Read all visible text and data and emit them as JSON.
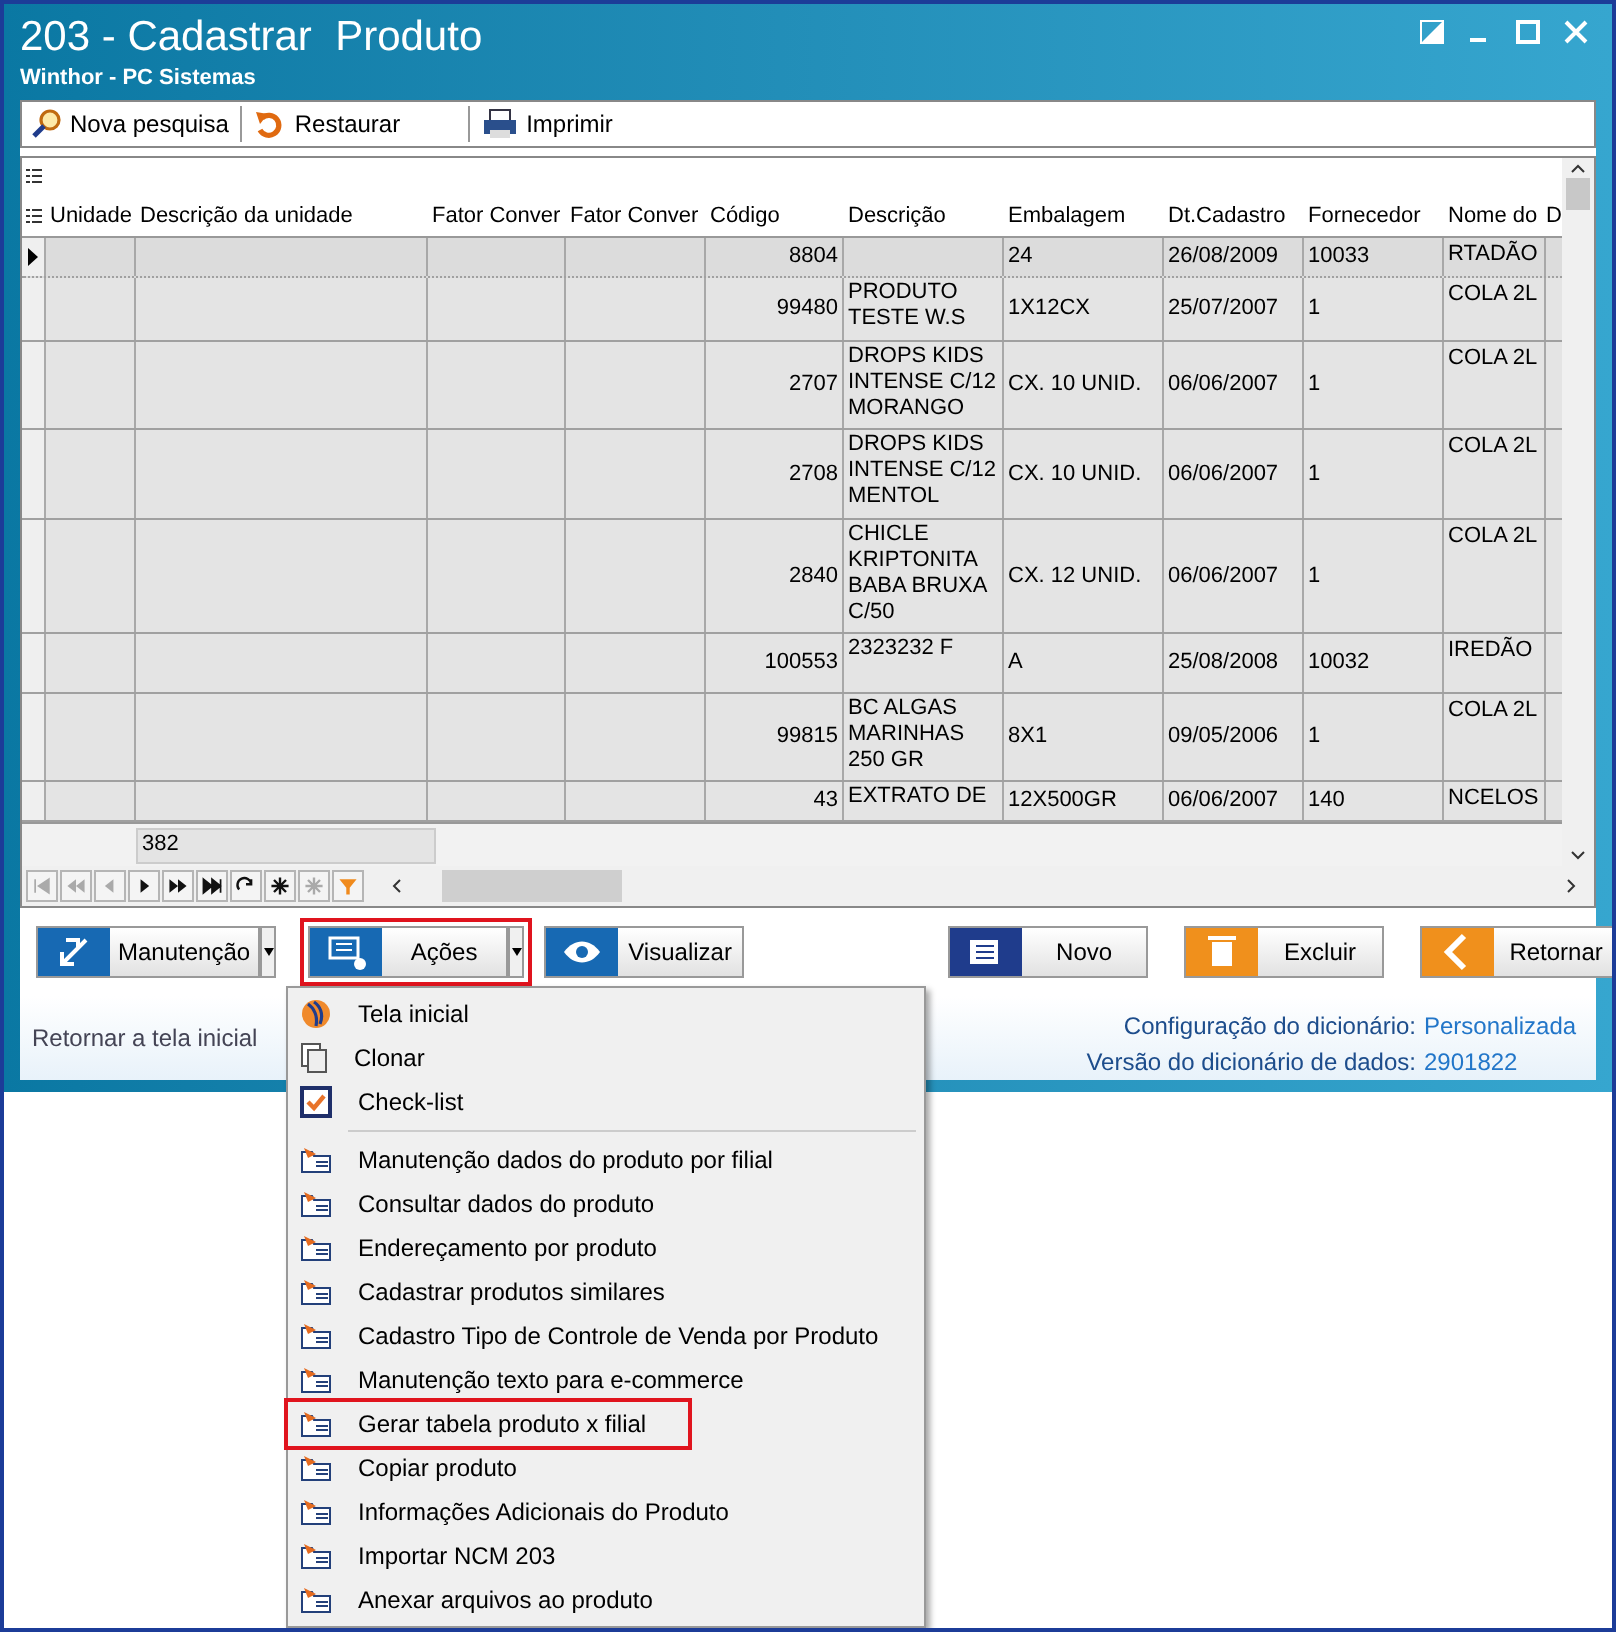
{
  "window": {
    "title": "203 - Cadastrar  Produto",
    "subtitle": "Winthor - PC Sistemas"
  },
  "toolbar": [
    {
      "label": "Nova pesquisa"
    },
    {
      "label": "Restaurar"
    },
    {
      "label": "Imprimir"
    }
  ],
  "table": {
    "columns": [
      "Unidade",
      "Descrição da unidade",
      "Fator Conver",
      "Fator Conver",
      "Código",
      "Descrição",
      "Embalagem",
      "Dt.Cadastro",
      "Fornecedor",
      "Nome do",
      "D"
    ],
    "rows": [
      {
        "selected": true,
        "cells": [
          "",
          "",
          "",
          "",
          "8804",
          "",
          "24",
          "26/08/2009",
          "10033",
          "RTADÃO"
        ]
      },
      {
        "selected": false,
        "cells": [
          "",
          "",
          "",
          "",
          "99480",
          "PRODUTO TESTE W.S",
          "1X12CX",
          "25/07/2007",
          "1",
          "COLA 2L"
        ]
      },
      {
        "selected": false,
        "cells": [
          "",
          "",
          "",
          "",
          "2707",
          "DROPS KIDS INTENSE C/12 MORANGO",
          "CX. 10 UNID.",
          "06/06/2007",
          "1",
          "COLA 2L"
        ]
      },
      {
        "selected": false,
        "cells": [
          "",
          "",
          "",
          "",
          "2708",
          "DROPS KIDS INTENSE C/12 MENTOL",
          "CX. 10 UNID.",
          "06/06/2007",
          "1",
          "COLA 2L"
        ]
      },
      {
        "selected": false,
        "cells": [
          "",
          "",
          "",
          "",
          "2840",
          "CHICLE KRIPTONITA BABA BRUXA C/50",
          "CX. 12 UNID.",
          "06/06/2007",
          "1",
          "COLA 2L"
        ]
      },
      {
        "selected": false,
        "cells": [
          "",
          "",
          "",
          "",
          "100553",
          "2323232 F",
          "A",
          "25/08/2008",
          "10032",
          "IREDÃO"
        ]
      },
      {
        "selected": false,
        "cells": [
          "",
          "",
          "",
          "",
          "99815",
          "BC ALGAS MARINHAS 250 GR",
          "8X1",
          "09/05/2006",
          "1",
          "COLA 2L"
        ]
      },
      {
        "selected": false,
        "cells": [
          "",
          "",
          "",
          "",
          "43",
          "EXTRATO DE",
          "12X500GR",
          "06/06/2007",
          "140",
          "NCELOS"
        ]
      }
    ],
    "summary": "382"
  },
  "navigator": [
    {
      "disabled": true
    },
    {
      "disabled": true
    },
    {
      "disabled": true
    },
    {
      "disabled": false
    },
    {
      "disabled": false
    },
    {
      "disabled": false
    },
    {
      "disabled": false
    },
    {
      "disabled": false
    },
    {
      "disabled": true
    },
    {
      "disabled": false
    }
  ],
  "buttons": [
    {
      "label": "Manutenção",
      "dropdown": true,
      "highlighted": false,
      "color": "#1769b3"
    },
    {
      "label": "Ações",
      "dropdown": true,
      "highlighted": true,
      "color": "#1769b3"
    },
    {
      "label": "Visualizar",
      "dropdown": false,
      "highlighted": false,
      "color": "#1769b3"
    },
    {
      "label": "Novo",
      "dropdown": false,
      "highlighted": false,
      "color": "#1f3c8c"
    },
    {
      "label": "Excluir",
      "dropdown": false,
      "highlighted": false,
      "color": "#f0901c"
    },
    {
      "label": "Retornar",
      "dropdown": false,
      "highlighted": false,
      "color": "#f0901c"
    }
  ],
  "footer": {
    "link": "Retornar a tela inicial",
    "info": [
      {
        "label": "Configuração do dicionário:",
        "value": "Personalizada"
      },
      {
        "label": "Versão do dicionário de dados:",
        "value": "2901822"
      }
    ]
  },
  "menu": {
    "groups": [
      [
        {
          "label": "Tela inicial",
          "highlighted": false
        },
        {
          "label": "Clonar",
          "highlighted": false
        },
        {
          "label": "Check-list",
          "highlighted": false
        }
      ],
      [
        {
          "label": "Manutenção dados do produto por filial",
          "highlighted": false
        },
        {
          "label": "Consultar dados do produto",
          "highlighted": false
        },
        {
          "label": "Endereçamento por produto",
          "highlighted": false
        },
        {
          "label": "Cadastrar produtos similares",
          "highlighted": false
        },
        {
          "label": "Cadastro Tipo de Controle de Venda por Produto",
          "highlighted": false
        },
        {
          "label": "Manutenção texto para e-commerce",
          "highlighted": false
        },
        {
          "label": "Gerar tabela produto x filial",
          "highlighted": true
        },
        {
          "label": "Copiar produto",
          "highlighted": false
        },
        {
          "label": "Informações Adicionais do Produto",
          "highlighted": false
        },
        {
          "label": "Importar NCM 203",
          "highlighted": false
        },
        {
          "label": "Anexar arquivos ao produto",
          "highlighted": false
        }
      ]
    ]
  }
}
